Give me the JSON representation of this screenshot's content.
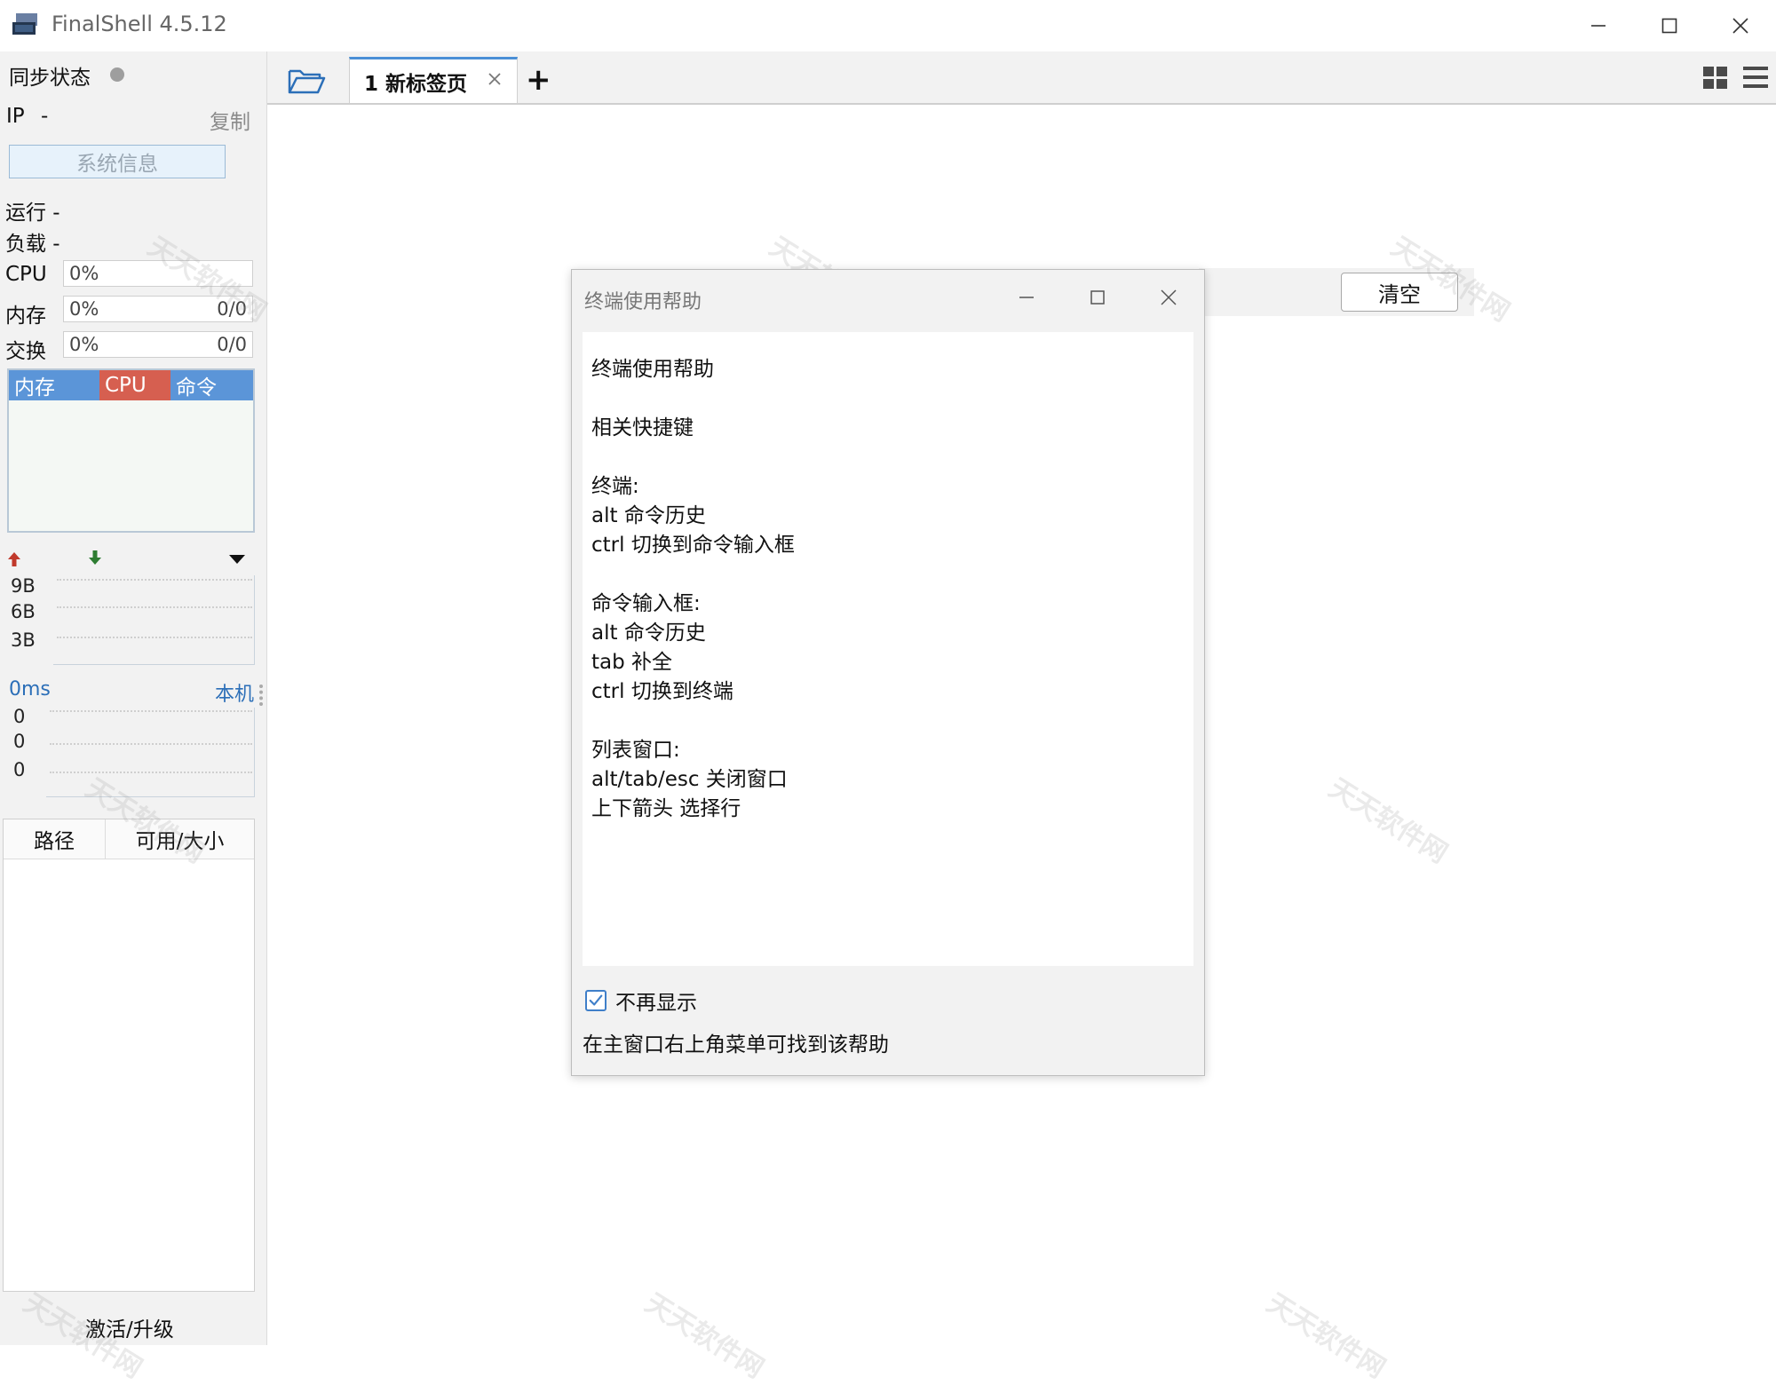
{
  "app": {
    "title": "FinalShell 4.5.12"
  },
  "window_controls": {
    "minimize": "minimize-icon",
    "maximize": "maximize-icon",
    "close": "close-icon"
  },
  "sidebar": {
    "sync_label": "同步状态",
    "ip_label": "IP",
    "ip_value": "-",
    "copy_label": "复制",
    "sysinfo_button": "系统信息",
    "run_label": "运行 -",
    "load_label": "负载 -",
    "cpu": {
      "label": "CPU",
      "percent": "0%"
    },
    "mem": {
      "label": "内存",
      "percent": "0%",
      "ratio": "0/0"
    },
    "swap": {
      "label": "交换",
      "percent": "0%",
      "ratio": "0/0"
    },
    "graph_tabs": [
      "内存",
      "CPU",
      "命令"
    ],
    "net": {
      "ticks": [
        "9B",
        "6B",
        "3B"
      ]
    },
    "latency": {
      "label": "0ms",
      "host": "本机",
      "values": [
        "0",
        "0",
        "0"
      ]
    },
    "disk_columns": [
      "路径",
      "可用/大小"
    ],
    "activate_label": "激活/升级"
  },
  "tabs": {
    "active_label": "1 新标签页",
    "add_label": "+"
  },
  "main": {
    "clear_button": "清空"
  },
  "dialog": {
    "title": "终端使用帮助",
    "lines": [
      "终端使用帮助",
      "",
      "相关快捷键",
      "",
      "终端:",
      "alt 命令历史",
      "ctrl 切换到命令输入框",
      "",
      "命令输入框:",
      "alt 命令历史",
      "tab 补全",
      "ctrl 切换到终端",
      "",
      "列表窗口:",
      "alt/tab/esc 关闭窗口",
      "上下箭头 选择行"
    ],
    "dont_show_label": "不再显示",
    "hint": "在主窗口右上角菜单可找到该帮助"
  },
  "watermark": "天天软件网",
  "colors": {
    "accent": "#4a8fd6",
    "graph_mem": "#5b95d8",
    "graph_cpu": "#d65f50",
    "up_arrow": "#c0392b",
    "down_arrow": "#2e7d32"
  }
}
